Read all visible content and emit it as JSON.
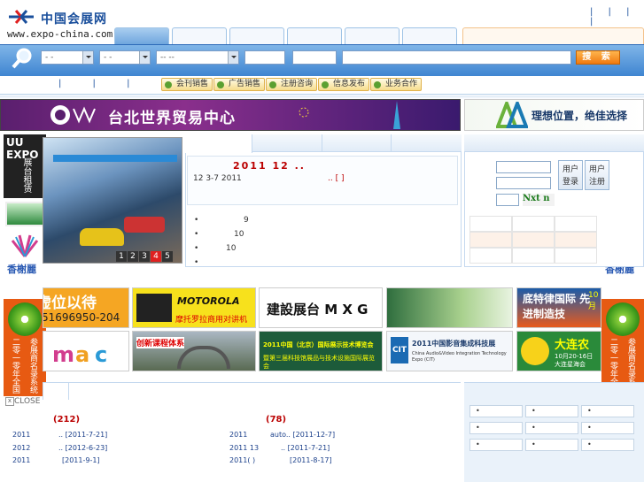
{
  "header": {
    "logo_cn": "中国会展网",
    "logo_url": "www.expo-china.com",
    "top_links": "| | | |"
  },
  "search": {
    "select1": "-  -",
    "select2": "-  -",
    "select3": "-- --",
    "button": "搜 索"
  },
  "subnav": {
    "pipes": "| | | |",
    "buttons": [
      "会刊销售",
      "广告销售",
      "注册咨询",
      "信息发布",
      "业务合作"
    ]
  },
  "banners": {
    "twtc_text": "台北世界贸易中心",
    "aa_text": "理想位置，绝佳选择"
  },
  "side_ads": {
    "uu_logo": "UU EXPO",
    "uu_text": "展台租赁",
    "xiangshu": "香榭麗",
    "disc_left": "二零一零年全国",
    "disc_right": "参展商名录系统",
    "close": "CLOSE"
  },
  "slideshow": {
    "pages": [
      "1",
      "2",
      "3",
      "4",
      "5"
    ],
    "active_page": "4"
  },
  "news": {
    "headline": "2011    12 ..",
    "sub": "12 3-7         2011",
    "sub_link": "..   [ ]",
    "items": [
      "9",
      "10",
      "10",
      ""
    ]
  },
  "login": {
    "login_button": "用户登录",
    "register_button": "用户注册",
    "captcha": "Nxt n"
  },
  "ads": {
    "row1": [
      "虚位以待",
      "MOTOROLA",
      "建設展台 M X G",
      "",
      "底特律国际 先进制造技"
    ],
    "row1_sub": [
      "51696950-204",
      "摩托罗拉商用对讲机",
      "",
      "",
      "10月"
    ],
    "row2": [
      "",
      "创新课程体系",
      "2011中国（北京）国际展示技术博览会",
      "2011中国影音集成科技展",
      "大连农"
    ],
    "row2_sub": [
      "",
      "",
      "暨第三届科技馆展品与技术设施国际展览会",
      "China Audio&Video Integration Technology Expo (CIT)",
      "10月20-16日 大连星海会"
    ]
  },
  "bottom": {
    "left_count": "(212)",
    "right_count": "(78)",
    "left_rows": [
      {
        "a": "2011",
        "b": ".. [2011-7-21]"
      },
      {
        "a": "2012",
        "b": ".. [2012-6-23]"
      },
      {
        "a": "2011",
        "b": "[2011-9-1]"
      }
    ],
    "right_rows": [
      {
        "a": "2011",
        "b": "auto.. [2011-12-7]"
      },
      {
        "a": "2011 13",
        "b": ".. [2011-7-21]"
      },
      {
        "a": "2011(  )",
        "b": "[2011-8-17]"
      }
    ],
    "boxes": [
      "•",
      "•",
      "•",
      "•",
      "•",
      "•",
      "•",
      "•",
      "•"
    ]
  }
}
